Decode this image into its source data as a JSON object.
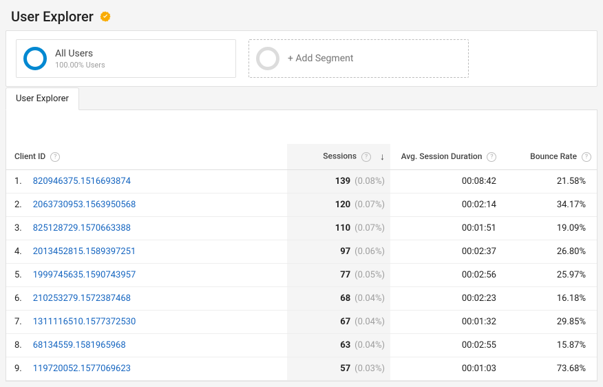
{
  "header": {
    "title": "User Explorer"
  },
  "segments": {
    "allUsers": {
      "title": "All Users",
      "subtitle": "100.00% Users"
    },
    "addLabel": "+ Add Segment"
  },
  "tabs": {
    "active": "User Explorer"
  },
  "table": {
    "columns": {
      "clientId": "Client ID",
      "sessions": "Sessions",
      "avgDuration": "Avg. Session Duration",
      "bounceRate": "Bounce Rate"
    },
    "rows": [
      {
        "idx": "1.",
        "clientId": "820946375.1516693874",
        "sessions": "139",
        "sessionsPct": "(0.08%)",
        "avgDuration": "00:08:42",
        "bounceRate": "21.58%"
      },
      {
        "idx": "2.",
        "clientId": "2063730953.1563950568",
        "sessions": "120",
        "sessionsPct": "(0.07%)",
        "avgDuration": "00:02:14",
        "bounceRate": "34.17%"
      },
      {
        "idx": "3.",
        "clientId": "825128729.1570663388",
        "sessions": "110",
        "sessionsPct": "(0.07%)",
        "avgDuration": "00:01:51",
        "bounceRate": "19.09%"
      },
      {
        "idx": "4.",
        "clientId": "2013452815.1589397251",
        "sessions": "97",
        "sessionsPct": "(0.06%)",
        "avgDuration": "00:02:37",
        "bounceRate": "26.80%"
      },
      {
        "idx": "5.",
        "clientId": "1999745635.1590743957",
        "sessions": "77",
        "sessionsPct": "(0.05%)",
        "avgDuration": "00:02:56",
        "bounceRate": "25.97%"
      },
      {
        "idx": "6.",
        "clientId": "210253279.1572387468",
        "sessions": "68",
        "sessionsPct": "(0.04%)",
        "avgDuration": "00:02:23",
        "bounceRate": "16.18%"
      },
      {
        "idx": "7.",
        "clientId": "1311116510.1577372530",
        "sessions": "67",
        "sessionsPct": "(0.04%)",
        "avgDuration": "00:01:32",
        "bounceRate": "29.85%"
      },
      {
        "idx": "8.",
        "clientId": "68134559.1581965968",
        "sessions": "63",
        "sessionsPct": "(0.04%)",
        "avgDuration": "00:02:55",
        "bounceRate": "15.87%"
      },
      {
        "idx": "9.",
        "clientId": "119720052.1577069623",
        "sessions": "57",
        "sessionsPct": "(0.03%)",
        "avgDuration": "00:01:03",
        "bounceRate": "73.68%"
      }
    ]
  }
}
